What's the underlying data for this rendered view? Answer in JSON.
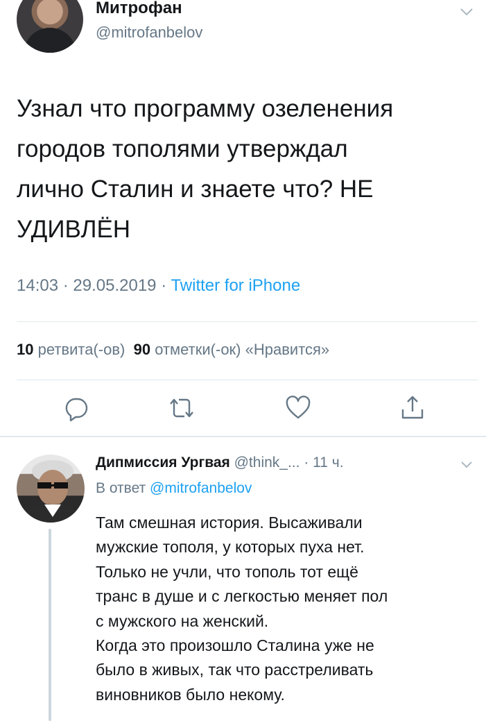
{
  "tweet": {
    "author_name": "Митрофан",
    "author_handle": "@mitrofanbelov",
    "text_lines": [
      "Узнал что программу озеленения",
      "городов тополями утверждал",
      "лично Сталин и знаете что? НЕ",
      "УДИВЛЁН"
    ],
    "time": "14:03",
    "date": "29.05.2019",
    "separator": "·",
    "source": "Twitter for iPhone",
    "retweets_count": "10",
    "retweets_label": "ретвита(-ов)",
    "likes_count": "90",
    "likes_label": "отметки(-ок) «Нравится»",
    "actions": [
      "reply-icon",
      "retweet-icon",
      "like-icon",
      "share-icon"
    ]
  },
  "reply": {
    "author_name": "Дипмиссия Ургвая",
    "author_handle": "@think_...",
    "time": "· 11 ч.",
    "reply_prefix": "В ответ",
    "reply_to_handle": "@mitrofanbelov",
    "text_lines": [
      "Там смешная история. Высаживали",
      "мужские тополя, у которых пуха нет.",
      "Только не учли, что тополь тот ещё",
      "транс в душе и с легкостью меняет пол",
      "с мужского на женский.",
      "Когда это произошло Сталина уже не",
      "было в живых, так что расстреливать",
      "виновников было некому."
    ]
  },
  "colors": {
    "text": "#14171a",
    "secondary": "#657786",
    "link": "#1da1f2",
    "divider": "#e1e8ed",
    "thread_line": "#ccd6dd"
  }
}
